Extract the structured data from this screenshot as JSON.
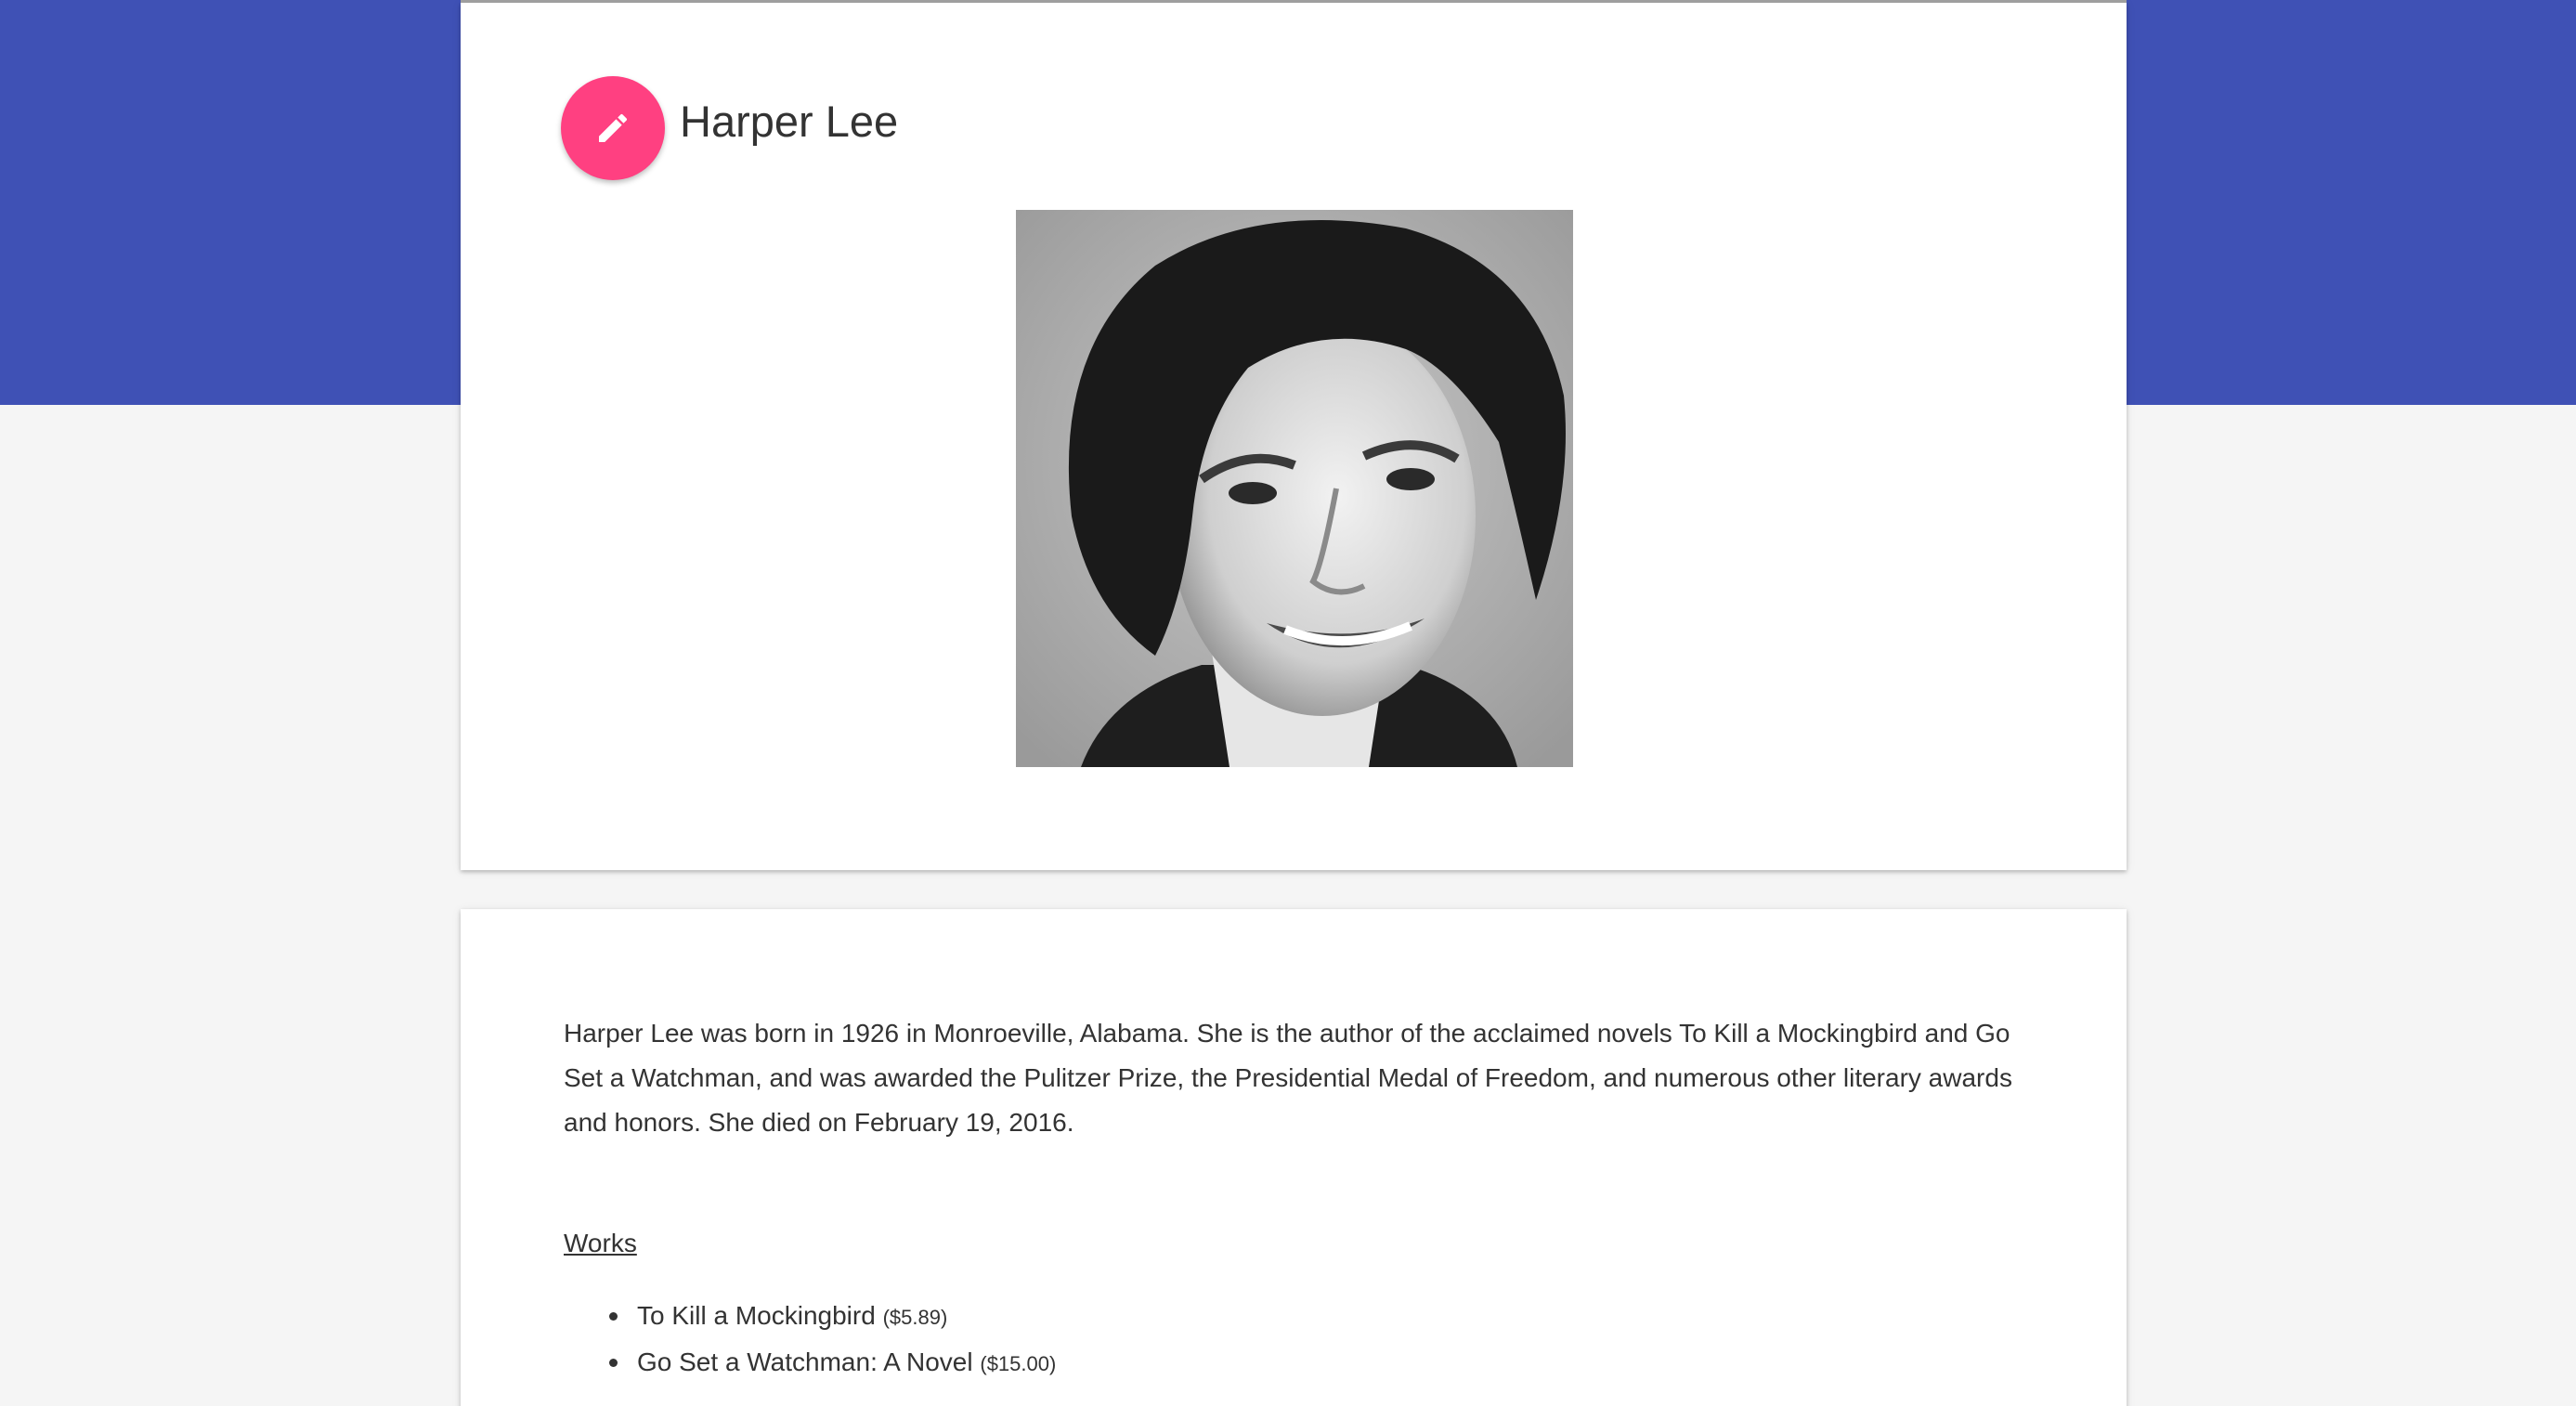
{
  "author": {
    "name": "Harper Lee",
    "edit_icon": "pencil-icon",
    "portrait_alt": "Harper Lee"
  },
  "bio": "Harper Lee was born in 1926 in Monroeville, Alabama. She is the author of the acclaimed novels To Kill a Mockingbird and Go Set a Watchman, and was awarded the Pulitzer Prize, the Presidential Medal of Freedom, and numerous other literary awards and honors. She died on February 19, 2016.",
  "works": {
    "heading": "Works",
    "items": [
      {
        "title": "To Kill a Mockingbird",
        "price": "($5.89)"
      },
      {
        "title": "Go Set a Watchman: A Novel",
        "price": "($15.00)"
      }
    ]
  },
  "colors": {
    "header_band": "#3f51b5",
    "fab": "#ff4081",
    "background": "#f5f5f5"
  }
}
